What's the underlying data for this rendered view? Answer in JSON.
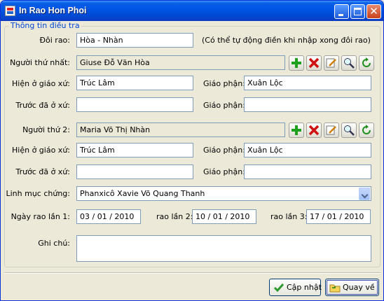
{
  "window": {
    "title": "In Rao Hon Phoi"
  },
  "group": {
    "legend": "Thông tin điều tra"
  },
  "form": {
    "doi_rao": {
      "label": "Đôi rao:",
      "value": "Hòa - Nhàn",
      "note": "(Có thể tự động điền khi nhập xong đôi rao)"
    },
    "nguoi1": {
      "label": "Người thứ nhất:",
      "value": "Giuse Đỗ Văn Hòa"
    },
    "hien_o_1": {
      "label": "Hiện ở giáo xứ:",
      "value": "Trúc Lâm",
      "giao_phan_label": "Giáo phận:",
      "giao_phan_value": "Xuân Lộc"
    },
    "truoc_1": {
      "label": "Trước đã ở xứ:",
      "value": "",
      "giao_phan_label": "Giáo phận:",
      "giao_phan_value": ""
    },
    "nguoi2": {
      "label": "Người thứ 2:",
      "value": "Maria Võ Thị Nhàn"
    },
    "hien_o_2": {
      "label": "Hiện ở giáo xứ:",
      "value": "Trúc Lâm",
      "giao_phan_label": "Giáo phận:",
      "giao_phan_value": "Xuân Lộc"
    },
    "truoc_2": {
      "label": "Trước đã ở xứ:",
      "value": "",
      "giao_phan_label": "Giáo phận:",
      "giao_phan_value": ""
    },
    "linh_muc": {
      "label": "Linh mục chứng:",
      "value": "Phanxicô Xavie Võ Quang Thanh"
    },
    "ngay_rao": {
      "label1": "Ngày rao lần 1:",
      "date1": "03 / 01 / 2010",
      "label2": "rao lần 2:",
      "date2": "10 / 01 / 2010",
      "label3": "rao lần 3:",
      "date3": "17 / 01 / 2010"
    },
    "ghi_chu": {
      "label": "Ghi chú:",
      "value": ""
    }
  },
  "row_icons": [
    "add-icon",
    "delete-icon",
    "edit-icon",
    "search-icon",
    "refresh-icon"
  ],
  "colors": {
    "accent": "#0054e3",
    "legend": "#0046d5",
    "add": "#1ea01e",
    "delete": "#d01010"
  },
  "buttons": {
    "cap_nhat": "Cập nhật",
    "quay_ve": "Quay về"
  }
}
